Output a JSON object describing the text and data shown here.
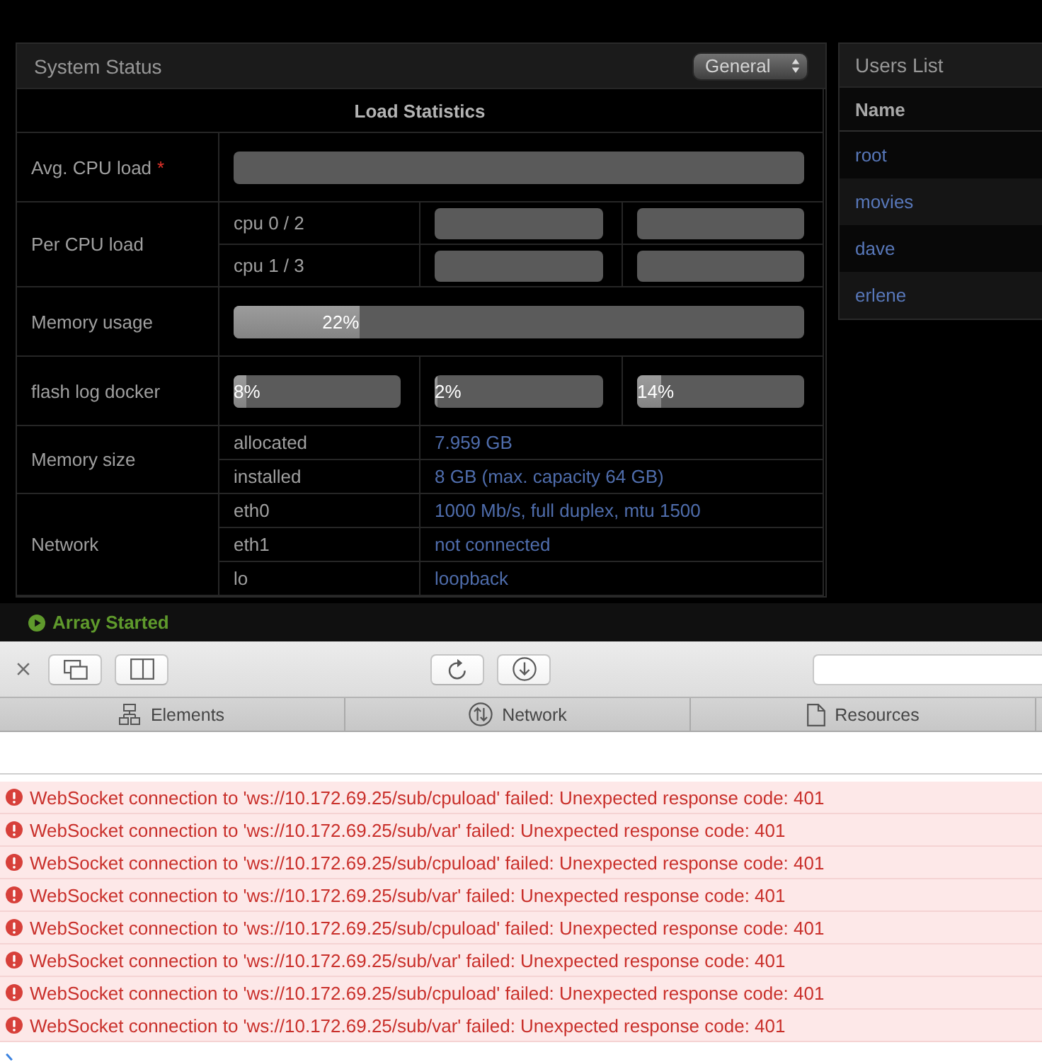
{
  "system_status": {
    "title": "System Status",
    "view_select": "General",
    "table": {
      "heading": "Load Statistics",
      "rows": [
        {
          "kind": "bars",
          "label": "Avg. CPU load",
          "required_mark": "*",
          "bars": [
            {
              "kind": "empty"
            }
          ]
        },
        {
          "kind": "sub_bars",
          "label": "Per CPU load",
          "subrows": [
            {
              "label": "cpu 0 / 2",
              "bars": [
                {
                  "kind": "empty"
                },
                {
                  "kind": "empty"
                }
              ]
            },
            {
              "label": "cpu 1 / 3",
              "bars": [
                {
                  "kind": "empty"
                },
                {
                  "kind": "empty"
                }
              ]
            }
          ]
        },
        {
          "kind": "bars",
          "label": "Memory usage",
          "bars": [
            {
              "kind": "meter",
              "level": 0.22,
              "reading": "22%"
            }
          ]
        },
        {
          "kind": "bars",
          "label": "flash log docker",
          "bars": [
            {
              "kind": "meter",
              "level": 0.08,
              "reading": "8%"
            },
            {
              "kind": "meter",
              "level": 0.02,
              "reading": "2%"
            },
            {
              "kind": "meter",
              "level": 0.14,
              "reading": "14%"
            }
          ]
        },
        {
          "kind": "values",
          "label": "Memory size",
          "subrows": [
            {
              "label": "allocated",
              "value": "7.959 GB"
            },
            {
              "label": "installed",
              "value": "8 GB (max. capacity 64 GB)"
            }
          ]
        },
        {
          "kind": "values",
          "label": "Network",
          "subrows": [
            {
              "label": "eth0",
              "value": "1000 Mb/s, full duplex, mtu 1500"
            },
            {
              "label": "eth1",
              "value": "not connected"
            },
            {
              "label": "lo",
              "value": "loopback"
            }
          ]
        }
      ]
    }
  },
  "users_list": {
    "title": "Users List",
    "columns": [
      "Name"
    ],
    "rows": [
      {
        "name": "root"
      },
      {
        "name": "movies"
      },
      {
        "name": "dave"
      },
      {
        "name": "erlene"
      }
    ]
  },
  "status_bar": {
    "label": "Array Started"
  },
  "inspector": {
    "tabs": [
      {
        "label": "Elements",
        "selected": false
      },
      {
        "label": "Network",
        "selected": false
      },
      {
        "label": "Resources",
        "selected": false
      }
    ],
    "console": [
      {
        "kind": "error",
        "text": "WebSocket connection to 'ws://10.172.69.25/sub/cpuload' failed: Unexpected response code: 401"
      },
      {
        "kind": "error",
        "text": "WebSocket connection to 'ws://10.172.69.25/sub/var' failed: Unexpected response code: 401"
      },
      {
        "kind": "error",
        "text": "WebSocket connection to 'ws://10.172.69.25/sub/cpuload' failed: Unexpected response code: 401"
      },
      {
        "kind": "error",
        "text": "WebSocket connection to 'ws://10.172.69.25/sub/var' failed: Unexpected response code: 401"
      },
      {
        "kind": "error",
        "text": "WebSocket connection to 'ws://10.172.69.25/sub/cpuload' failed: Unexpected response code: 401"
      },
      {
        "kind": "error",
        "text": "WebSocket connection to 'ws://10.172.69.25/sub/var' failed: Unexpected response code: 401"
      },
      {
        "kind": "error",
        "text": "WebSocket connection to 'ws://10.172.69.25/sub/cpuload' failed: Unexpected response code: 401"
      },
      {
        "kind": "error",
        "text": "WebSocket connection to 'ws://10.172.69.25/sub/var' failed: Unexpected response code: 401"
      }
    ]
  }
}
